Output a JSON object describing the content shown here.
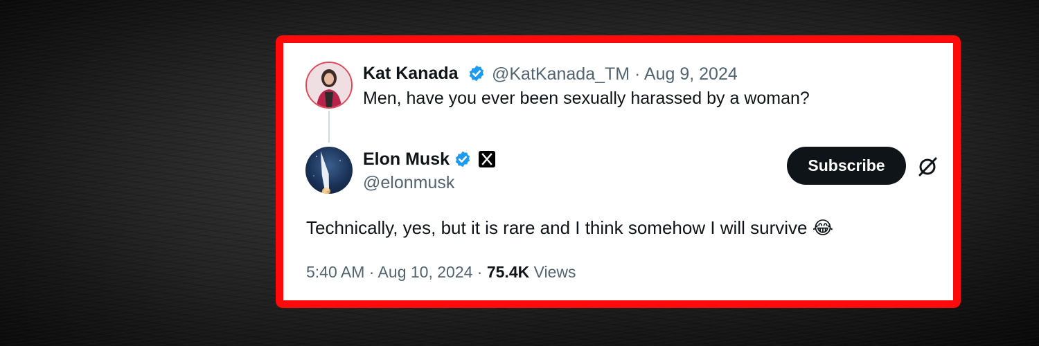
{
  "parent_post": {
    "author_name": "Kat Kanada",
    "handle_date": "@KatKanada_TM · Aug 9, 2024",
    "text": "Men, have you ever been sexually harassed by a woman?"
  },
  "reply_post": {
    "author_name": "Elon Musk",
    "handle": "@elonmusk",
    "subscribe_label": "Subscribe",
    "text": "Technically, yes, but it is rare and I think somehow I will survive",
    "emoji": "😂",
    "time_date": "5:40 AM · Aug 10, 2024 · ",
    "views_count": "75.4K",
    "views_label": "Views"
  },
  "icons": {
    "verified": "verified-badge-icon",
    "affiliate": "x-logo-icon",
    "grok": "grok-slash-icon"
  },
  "colors": {
    "frame_red": "#ff0a0a",
    "verified_blue": "#1d9bf0",
    "text_primary": "#0f1419",
    "text_muted": "#536471",
    "button_bg": "#0f1419"
  }
}
